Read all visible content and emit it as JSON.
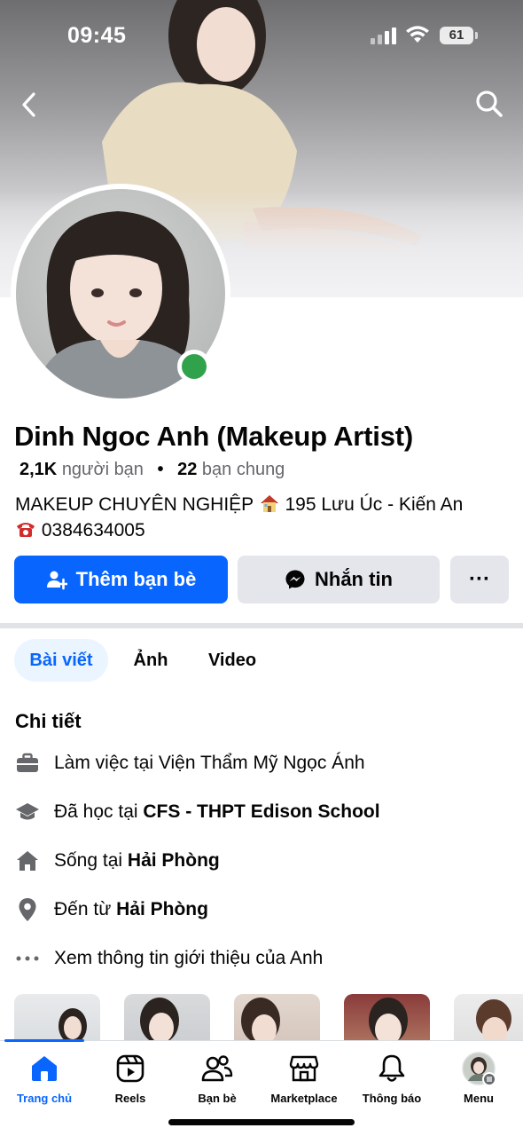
{
  "status_bar": {
    "time": "09:45",
    "battery": "61"
  },
  "profile": {
    "name": "Dinh Ngoc Anh (Makeup Artist)",
    "friends_count": "2,1K",
    "friends_label": "người bạn",
    "mutual_count": "22",
    "mutual_label": "bạn chung",
    "bio_line1_a": "MAKEUP CHUYÊN NGHIỆP",
    "bio_line1_b": "195 Lưu Úc - Kiến An",
    "bio_line2": "0384634005",
    "online": true
  },
  "actions": {
    "add_friend": "Thêm bạn bè",
    "message": "Nhắn tin",
    "more": "···"
  },
  "tabs": [
    {
      "label": "Bài viết",
      "active": true
    },
    {
      "label": "Ảnh",
      "active": false
    },
    {
      "label": "Video",
      "active": false
    }
  ],
  "details": {
    "title": "Chi tiết",
    "work_prefix": "Làm việc tại Viện Thẩm Mỹ Ngọc Ánh",
    "study_prefix": "Đã học tại ",
    "study_value": "CFS - THPT Edison School",
    "lives_prefix": "Sống tại ",
    "lives_value": "Hải Phòng",
    "from_prefix": "Đến từ ",
    "from_value": "Hải Phòng",
    "more_info": "Xem thông tin giới thiệu của Anh"
  },
  "bottom_nav": [
    {
      "label": "Trang chủ",
      "icon": "home-icon",
      "active": true
    },
    {
      "label": "Reels",
      "icon": "reels-icon",
      "active": false
    },
    {
      "label": "Bạn bè",
      "icon": "friends-icon",
      "active": false
    },
    {
      "label": "Marketplace",
      "icon": "marketplace-icon",
      "active": false
    },
    {
      "label": "Thông báo",
      "icon": "bell-icon",
      "active": false
    },
    {
      "label": "Menu",
      "icon": "profile-avatar-icon",
      "active": false
    }
  ],
  "colors": {
    "accent": "#0866ff",
    "online": "#31a24c",
    "secondary_button": "#e4e6eb",
    "tab_active_bg": "#ebf5ff"
  }
}
